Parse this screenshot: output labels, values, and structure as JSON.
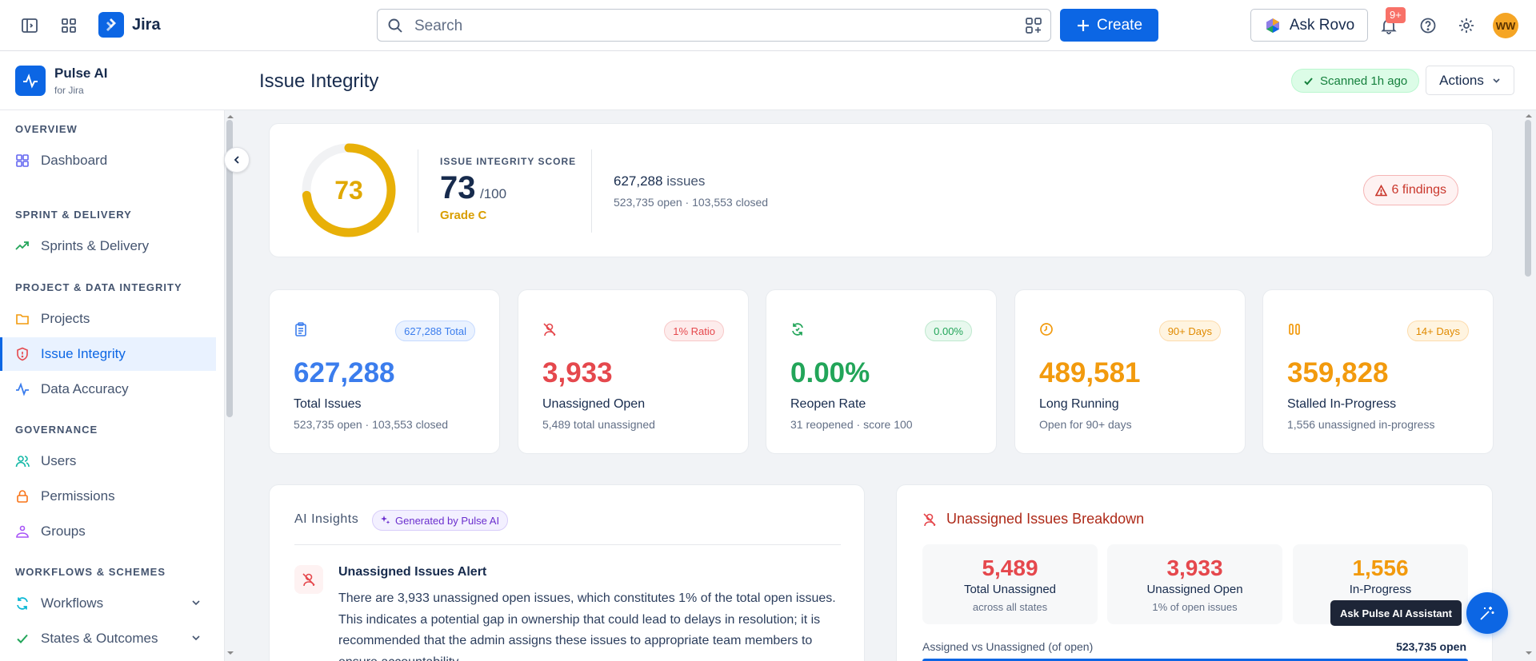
{
  "topbar": {
    "app_name": "Jira",
    "search_placeholder": "Search",
    "create_label": "Create",
    "rovo_label": "Ask Rovo",
    "notification_count": "9+",
    "avatar_initials": "WW"
  },
  "app": {
    "name": "Pulse AI",
    "subtitle": "for Jira"
  },
  "header": {
    "title": "Issue Integrity",
    "scanned": "Scanned 1h ago",
    "actions_label": "Actions"
  },
  "sidebar": {
    "sections": [
      {
        "label": "OVERVIEW"
      },
      {
        "label": "SPRINT & DELIVERY"
      },
      {
        "label": "PROJECT & DATA INTEGRITY"
      },
      {
        "label": "GOVERNANCE"
      },
      {
        "label": "WORKFLOWS & SCHEMES"
      }
    ],
    "items": [
      {
        "label": "Dashboard",
        "icon": "grid-icon"
      },
      {
        "label": "Sprints & Delivery",
        "icon": "trend-up-icon"
      },
      {
        "label": "Projects",
        "icon": "folder-icon"
      },
      {
        "label": "Issue Integrity",
        "icon": "shield-icon",
        "active": true
      },
      {
        "label": "Data Accuracy",
        "icon": "activity-icon"
      },
      {
        "label": "Users",
        "icon": "users-icon"
      },
      {
        "label": "Permissions",
        "icon": "lock-icon"
      },
      {
        "label": "Groups",
        "icon": "groups-icon"
      },
      {
        "label": "Workflows",
        "icon": "refresh-icon"
      },
      {
        "label": "States & Outcomes",
        "icon": "check-icon"
      }
    ]
  },
  "score": {
    "ring_value": "73",
    "ring_fraction": 0.73,
    "label": "ISSUE INTEGRITY SCORE",
    "value": "73",
    "max": "/100",
    "grade": "Grade C",
    "issues_count": "627,288",
    "issues_word": "issues",
    "issues_sub": "523,735 open · 103,553 closed",
    "findings": "6 findings"
  },
  "stats": [
    {
      "badge": "627,288 Total",
      "value": "627,288",
      "label": "Total Issues",
      "sub": "523,735 open · 103,553 closed",
      "color": "#3b7ded"
    },
    {
      "badge": "1% Ratio",
      "value": "3,933",
      "label": "Unassigned Open",
      "sub": "5,489 total unassigned",
      "color": "#e5484d"
    },
    {
      "badge": "0.00%",
      "value": "0.00%",
      "label": "Reopen Rate",
      "sub": "31 reopened · score 100",
      "color": "#22a559"
    },
    {
      "badge": "90+ Days",
      "value": "489,581",
      "label": "Long Running",
      "sub": "Open for 90+ days",
      "color": "#f29a0d"
    },
    {
      "badge": "14+ Days",
      "value": "359,828",
      "label": "Stalled In-Progress",
      "sub": "1,556 unassigned in-progress",
      "color": "#f29a0d"
    }
  ],
  "ai": {
    "title": "AI Insights",
    "chip": "Generated by Pulse AI",
    "item_title": "Unassigned Issues Alert",
    "item_text": "There are 3,933 unassigned open issues, which constitutes 1% of the total open issues. This indicates a potential gap in ownership that could lead to delays in resolution; it is recommended that the admin assigns these issues to appropriate team members to ensure accountability."
  },
  "unassigned": {
    "title": "Unassigned Issues Breakdown",
    "boxes": [
      {
        "value": "5,489",
        "label": "Total Unassigned",
        "sub": "across all states",
        "color": "#e5484d"
      },
      {
        "value": "3,933",
        "label": "Unassigned Open",
        "sub": "1% of open issues",
        "color": "#e5484d"
      },
      {
        "value": "1,556",
        "label": "In-Progress",
        "sub": "",
        "color": "#f29a0d"
      }
    ],
    "bar_label": "Assigned vs Unassigned (of open)",
    "bar_value": "523,735 open"
  },
  "assistant": {
    "tooltip": "Ask Pulse AI Assistant"
  }
}
